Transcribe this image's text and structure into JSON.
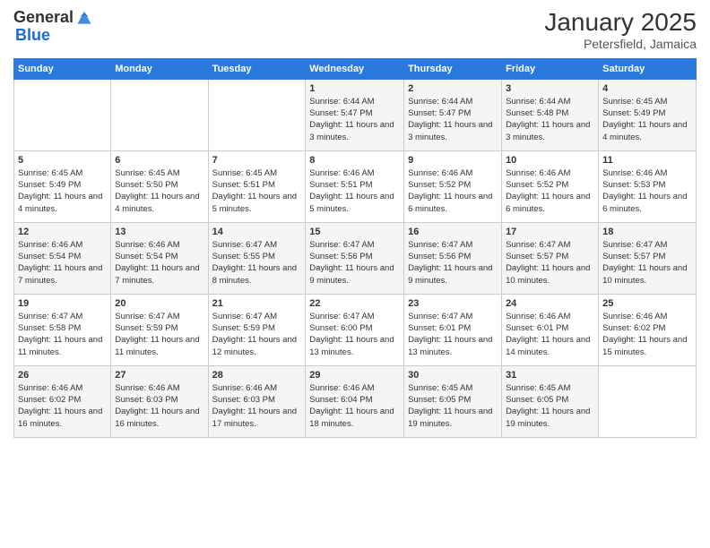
{
  "header": {
    "logo_general": "General",
    "logo_blue": "Blue",
    "month_year": "January 2025",
    "location": "Petersfield, Jamaica"
  },
  "weekdays": [
    "Sunday",
    "Monday",
    "Tuesday",
    "Wednesday",
    "Thursday",
    "Friday",
    "Saturday"
  ],
  "weeks": [
    [
      {
        "day": "",
        "sunrise": "",
        "sunset": "",
        "daylight": ""
      },
      {
        "day": "",
        "sunrise": "",
        "sunset": "",
        "daylight": ""
      },
      {
        "day": "",
        "sunrise": "",
        "sunset": "",
        "daylight": ""
      },
      {
        "day": "1",
        "sunrise": "Sunrise: 6:44 AM",
        "sunset": "Sunset: 5:47 PM",
        "daylight": "Daylight: 11 hours and 3 minutes."
      },
      {
        "day": "2",
        "sunrise": "Sunrise: 6:44 AM",
        "sunset": "Sunset: 5:47 PM",
        "daylight": "Daylight: 11 hours and 3 minutes."
      },
      {
        "day": "3",
        "sunrise": "Sunrise: 6:44 AM",
        "sunset": "Sunset: 5:48 PM",
        "daylight": "Daylight: 11 hours and 3 minutes."
      },
      {
        "day": "4",
        "sunrise": "Sunrise: 6:45 AM",
        "sunset": "Sunset: 5:49 PM",
        "daylight": "Daylight: 11 hours and 4 minutes."
      }
    ],
    [
      {
        "day": "5",
        "sunrise": "Sunrise: 6:45 AM",
        "sunset": "Sunset: 5:49 PM",
        "daylight": "Daylight: 11 hours and 4 minutes."
      },
      {
        "day": "6",
        "sunrise": "Sunrise: 6:45 AM",
        "sunset": "Sunset: 5:50 PM",
        "daylight": "Daylight: 11 hours and 4 minutes."
      },
      {
        "day": "7",
        "sunrise": "Sunrise: 6:45 AM",
        "sunset": "Sunset: 5:51 PM",
        "daylight": "Daylight: 11 hours and 5 minutes."
      },
      {
        "day": "8",
        "sunrise": "Sunrise: 6:46 AM",
        "sunset": "Sunset: 5:51 PM",
        "daylight": "Daylight: 11 hours and 5 minutes."
      },
      {
        "day": "9",
        "sunrise": "Sunrise: 6:46 AM",
        "sunset": "Sunset: 5:52 PM",
        "daylight": "Daylight: 11 hours and 6 minutes."
      },
      {
        "day": "10",
        "sunrise": "Sunrise: 6:46 AM",
        "sunset": "Sunset: 5:52 PM",
        "daylight": "Daylight: 11 hours and 6 minutes."
      },
      {
        "day": "11",
        "sunrise": "Sunrise: 6:46 AM",
        "sunset": "Sunset: 5:53 PM",
        "daylight": "Daylight: 11 hours and 6 minutes."
      }
    ],
    [
      {
        "day": "12",
        "sunrise": "Sunrise: 6:46 AM",
        "sunset": "Sunset: 5:54 PM",
        "daylight": "Daylight: 11 hours and 7 minutes."
      },
      {
        "day": "13",
        "sunrise": "Sunrise: 6:46 AM",
        "sunset": "Sunset: 5:54 PM",
        "daylight": "Daylight: 11 hours and 7 minutes."
      },
      {
        "day": "14",
        "sunrise": "Sunrise: 6:47 AM",
        "sunset": "Sunset: 5:55 PM",
        "daylight": "Daylight: 11 hours and 8 minutes."
      },
      {
        "day": "15",
        "sunrise": "Sunrise: 6:47 AM",
        "sunset": "Sunset: 5:56 PM",
        "daylight": "Daylight: 11 hours and 9 minutes."
      },
      {
        "day": "16",
        "sunrise": "Sunrise: 6:47 AM",
        "sunset": "Sunset: 5:56 PM",
        "daylight": "Daylight: 11 hours and 9 minutes."
      },
      {
        "day": "17",
        "sunrise": "Sunrise: 6:47 AM",
        "sunset": "Sunset: 5:57 PM",
        "daylight": "Daylight: 11 hours and 10 minutes."
      },
      {
        "day": "18",
        "sunrise": "Sunrise: 6:47 AM",
        "sunset": "Sunset: 5:57 PM",
        "daylight": "Daylight: 11 hours and 10 minutes."
      }
    ],
    [
      {
        "day": "19",
        "sunrise": "Sunrise: 6:47 AM",
        "sunset": "Sunset: 5:58 PM",
        "daylight": "Daylight: 11 hours and 11 minutes."
      },
      {
        "day": "20",
        "sunrise": "Sunrise: 6:47 AM",
        "sunset": "Sunset: 5:59 PM",
        "daylight": "Daylight: 11 hours and 11 minutes."
      },
      {
        "day": "21",
        "sunrise": "Sunrise: 6:47 AM",
        "sunset": "Sunset: 5:59 PM",
        "daylight": "Daylight: 11 hours and 12 minutes."
      },
      {
        "day": "22",
        "sunrise": "Sunrise: 6:47 AM",
        "sunset": "Sunset: 6:00 PM",
        "daylight": "Daylight: 11 hours and 13 minutes."
      },
      {
        "day": "23",
        "sunrise": "Sunrise: 6:47 AM",
        "sunset": "Sunset: 6:01 PM",
        "daylight": "Daylight: 11 hours and 13 minutes."
      },
      {
        "day": "24",
        "sunrise": "Sunrise: 6:46 AM",
        "sunset": "Sunset: 6:01 PM",
        "daylight": "Daylight: 11 hours and 14 minutes."
      },
      {
        "day": "25",
        "sunrise": "Sunrise: 6:46 AM",
        "sunset": "Sunset: 6:02 PM",
        "daylight": "Daylight: 11 hours and 15 minutes."
      }
    ],
    [
      {
        "day": "26",
        "sunrise": "Sunrise: 6:46 AM",
        "sunset": "Sunset: 6:02 PM",
        "daylight": "Daylight: 11 hours and 16 minutes."
      },
      {
        "day": "27",
        "sunrise": "Sunrise: 6:46 AM",
        "sunset": "Sunset: 6:03 PM",
        "daylight": "Daylight: 11 hours and 16 minutes."
      },
      {
        "day": "28",
        "sunrise": "Sunrise: 6:46 AM",
        "sunset": "Sunset: 6:03 PM",
        "daylight": "Daylight: 11 hours and 17 minutes."
      },
      {
        "day": "29",
        "sunrise": "Sunrise: 6:46 AM",
        "sunset": "Sunset: 6:04 PM",
        "daylight": "Daylight: 11 hours and 18 minutes."
      },
      {
        "day": "30",
        "sunrise": "Sunrise: 6:45 AM",
        "sunset": "Sunset: 6:05 PM",
        "daylight": "Daylight: 11 hours and 19 minutes."
      },
      {
        "day": "31",
        "sunrise": "Sunrise: 6:45 AM",
        "sunset": "Sunset: 6:05 PM",
        "daylight": "Daylight: 11 hours and 19 minutes."
      },
      {
        "day": "",
        "sunrise": "",
        "sunset": "",
        "daylight": ""
      }
    ]
  ]
}
